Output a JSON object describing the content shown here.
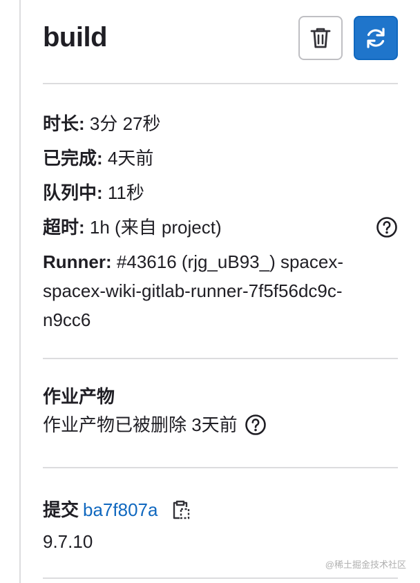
{
  "job": {
    "title": "build",
    "erase_icon": "trash-icon",
    "retry_icon": "retry-icon"
  },
  "details": {
    "duration_label": "时长:",
    "duration_value": " 3分 27秒",
    "finished_label": "已完成:",
    "finished_value": " 4天前",
    "queued_label": "队列中:",
    "queued_value": " 11秒",
    "timeout_label": "超时:",
    "timeout_value": " 1h (来自 project)",
    "runner_label": "Runner:",
    "runner_value": " #43616 (rjg_uB93_) spacex-spacex-wiki-gitlab-runner-7f5f56dc9c-n9cc6"
  },
  "artifacts": {
    "title": "作业产物",
    "message": "作业产物已被删除 3天前"
  },
  "commit": {
    "label": "提交",
    "sha": "ba7f807a",
    "message": "9.7.10"
  },
  "watermark": "@稀土掘金技术社区",
  "colors": {
    "primary": "#1f75cb",
    "link": "#1068bf",
    "text": "#1f1e24",
    "divider": "#dcdcde"
  }
}
